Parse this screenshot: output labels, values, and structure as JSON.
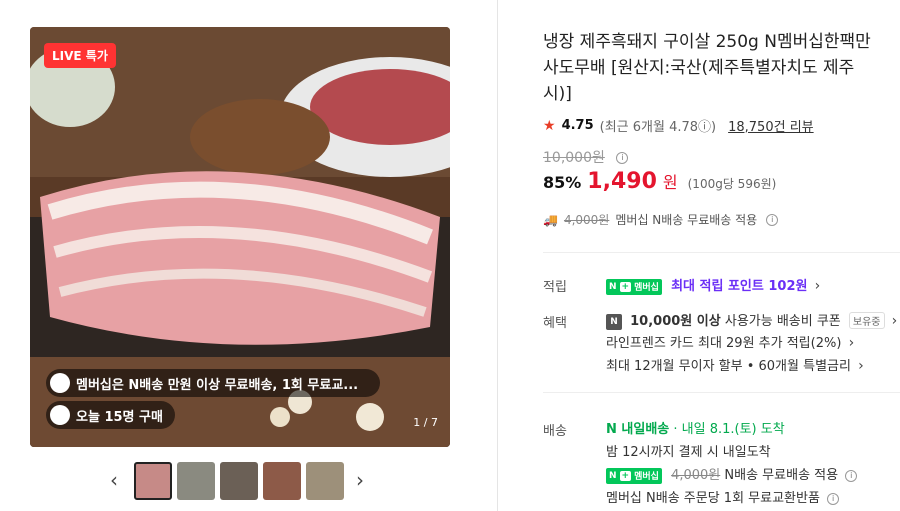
{
  "gallery": {
    "live_badge": "LIVE 특가",
    "pill_membership": "멤버십은 N배송 만원 이상 무료배송, 1회 무료교...",
    "pill_orders": "오늘 15명 구매",
    "pager": "1 / 7",
    "prev_icon": "chevron-left-icon",
    "next_icon": "chevron-right-icon",
    "thumbnails": 5
  },
  "product": {
    "title": "냉장 제주흑돼지 구이살 250g N멤버십한팩만사도무배 [원산지:국산(제주특별자치도 제주시)]",
    "rating_score": "4.75",
    "rating_recent": "(최근 6개월 4.78ⓘ)",
    "review_count": "18,750건 리뷰",
    "original_price": "10,000원",
    "discount": "85%",
    "price": "1,490",
    "price_unit": "원",
    "unit_price": "(100g당 596원)",
    "shipping_struck": "4,000원",
    "shipping_text": "멤버십 N배송 무료배송 적용"
  },
  "benefits": {
    "point_label": "적립",
    "point_badge": "멤버십",
    "point_text": "최대 적립 포인트 102원",
    "benefit_label": "혜택",
    "coupon_bold": "10,000원 이상",
    "coupon_text": "사용가능 배송비 쿠폰",
    "coupon_tag": "보유중",
    "card_text": "라인프렌즈 카드 최대 29원 추가 적립(2%)",
    "installment_text": "최대 12개월 무이자 할부 • 60개월 특별금리"
  },
  "delivery": {
    "label": "배송",
    "brand": "내일배송",
    "date": "내일 8.1.(토) 도착",
    "cutoff": "밤 12시까지 결제 시 내일도착",
    "badge": "멤버십",
    "struck": "4,000원",
    "free_text": "N배송 무료배송 적용",
    "exchange_text": "멤버십 N배송 주문당 1회 무료교환반품"
  },
  "colors": {
    "price_red": "#e4152e",
    "membership_green": "#03c75a",
    "point_purple": "#6b2ff6"
  }
}
